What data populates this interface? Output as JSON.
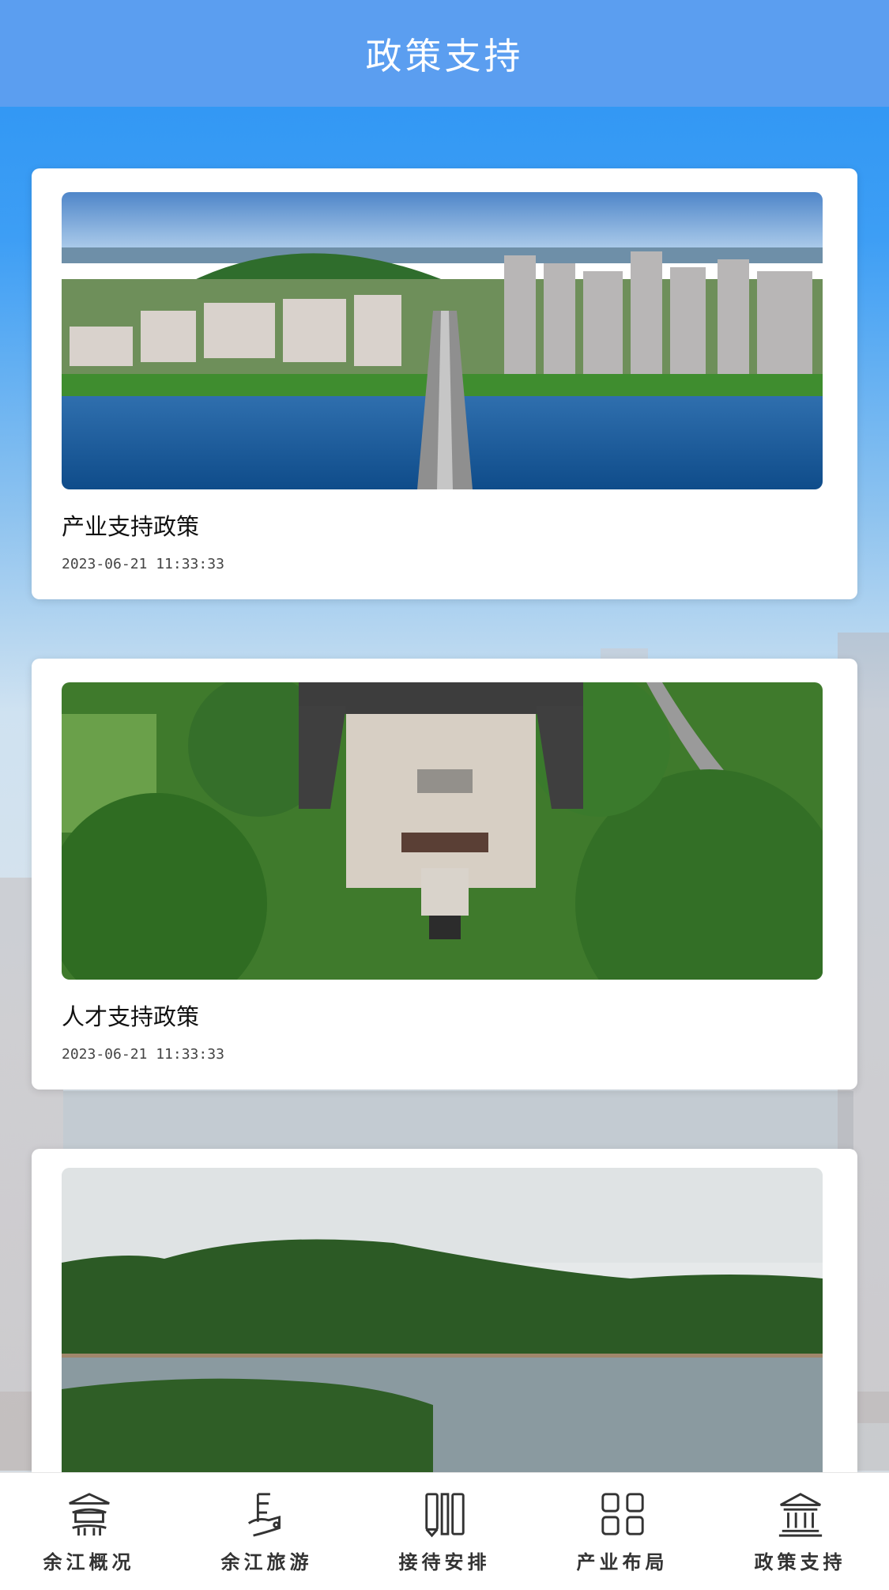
{
  "header": {
    "title": "政策支持"
  },
  "cards": [
    {
      "title": "产业支持政策",
      "time": "2023-06-21 11:33:33",
      "image": "city-river-aerial-photo"
    },
    {
      "title": "人才支持政策",
      "time": "2023-06-21 11:33:33",
      "image": "courtyard-aerial-photo"
    },
    {
      "title": "",
      "time": "",
      "image": "lake-mountain-photo"
    }
  ],
  "tabbar": {
    "items": [
      {
        "label": "余江概况",
        "icon": "pavilion-icon"
      },
      {
        "label": "余江旅游",
        "icon": "travel-icon"
      },
      {
        "label": "接待安排",
        "icon": "columns-icon"
      },
      {
        "label": "产业布局",
        "icon": "grid-icon"
      },
      {
        "label": "政策支持",
        "icon": "temple-icon"
      }
    ]
  }
}
